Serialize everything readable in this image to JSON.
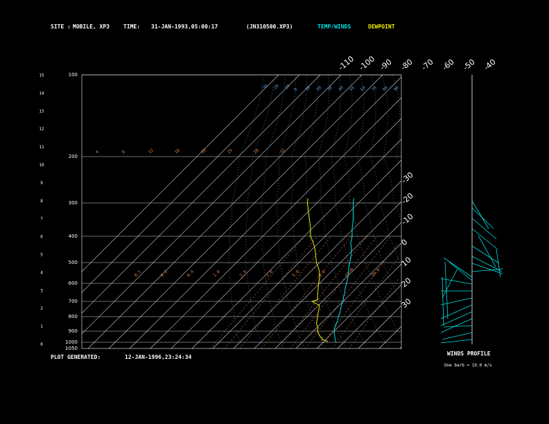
{
  "header": {
    "site_label": "SITE :",
    "site_value": "MOBILE, XP3",
    "time_label": "TIME:",
    "time_value": "31-JAN-1993,05:00:17",
    "file_value": "(JN310500.XP3)",
    "temp_legend": "TEMP/WINDS",
    "dew_legend": "DEWPOINT"
  },
  "footer": {
    "generated_label": "PLOT GENERATED:",
    "generated_value": "12-JAN-1996,23:24:34",
    "wind_title": "WINDS PROFILE",
    "wind_note": "One barb = 10.0 m/s"
  },
  "colors": {
    "background": "#000000",
    "grid": "#d8d8d8",
    "temp": "#00e5e5",
    "dewpoint": "#f0f000",
    "mixing": "#e08040",
    "isotherm_label": "#5b9bd5"
  },
  "chart_data": {
    "type": "line",
    "chart_kind": "skew-T log-p sounding",
    "pressure_levels_hpa": [
      "100",
      "200",
      "300",
      "400",
      "500",
      "600",
      "700",
      "800",
      "900",
      "1000",
      "1050"
    ],
    "height_axis_km": [
      "0",
      "1",
      "2",
      "3",
      "4",
      "5",
      "6",
      "7",
      "8",
      "9",
      "10",
      "11",
      "12",
      "13",
      "14",
      "15"
    ],
    "top_temperature_labels": [
      "-110",
      "-100",
      "-90",
      "-80",
      "-70",
      "-60",
      "-50",
      "-40"
    ],
    "right_temperature_labels": [
      "-30",
      "-20",
      "-10",
      "0",
      "10",
      "20",
      "30"
    ],
    "mixing_ratio_labels_upper": [
      "4",
      "8",
      "12",
      "16",
      "20",
      "24",
      "28",
      "32"
    ],
    "mixing_ratio_labels_lower": [
      "0.1",
      "0.2",
      "0.4",
      "1.0",
      "2.0",
      "3.0",
      "5.0",
      "8.0",
      "12.0",
      "20.0"
    ],
    "adiabat_labels": [
      "-30",
      "-20",
      "-10",
      "0",
      "10",
      "20",
      "30",
      "40",
      "50",
      "60",
      "70",
      "80",
      "90",
      "100",
      "110",
      "120",
      "130",
      "140",
      "150",
      "160",
      "170"
    ],
    "series": [
      {
        "name": "TEMP/WINDS",
        "pressure": [
          1000,
          975,
          950,
          925,
          900,
          875,
          850,
          825,
          800,
          775,
          750,
          725,
          700,
          675,
          650,
          625,
          600,
          575,
          550,
          525,
          500,
          475,
          450,
          425,
          400,
          375,
          350,
          325,
          300,
          290
        ],
        "temperature": [
          16,
          14.5,
          13,
          11.5,
          10,
          8.5,
          7.5,
          6.5,
          5,
          4,
          2.5,
          1,
          0,
          -2,
          -3.5,
          -5.5,
          -7,
          -9,
          -11,
          -13.5,
          -15.5,
          -18,
          -21,
          -24.5,
          -27,
          -31,
          -34.5,
          -38.5,
          -42.5,
          -44.5
        ]
      },
      {
        "name": "DEWPOINT",
        "pressure": [
          1000,
          990,
          975,
          960,
          950,
          925,
          900,
          875,
          850,
          825,
          800,
          775,
          750,
          725,
          710,
          700,
          690,
          675,
          650,
          625,
          600,
          575,
          550,
          525,
          500,
          475,
          450,
          425,
          400,
          375,
          350,
          325,
          300,
          290
        ],
        "temperature": [
          12,
          11.5,
          8,
          7.5,
          6,
          4,
          2,
          0.5,
          -2,
          -3.5,
          -5,
          -6.5,
          -8,
          -9.5,
          -13,
          -15,
          -13,
          -14.5,
          -16.5,
          -18.5,
          -20.5,
          -22.5,
          -25,
          -28,
          -31.5,
          -35,
          -38.5,
          -42.5,
          -47,
          -51,
          -55.5,
          -60,
          -64.5,
          -66.5
        ]
      }
    ]
  }
}
